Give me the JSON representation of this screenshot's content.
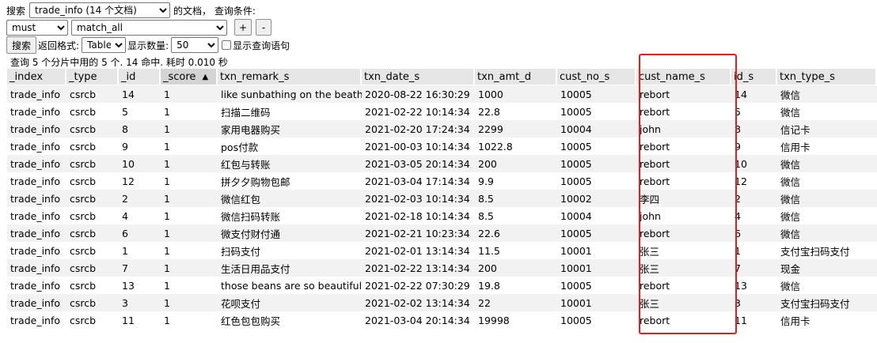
{
  "search_bar": {
    "label": "搜索",
    "index_select": "trade_info (14 个文档)",
    "suffix": "的文档， 查询条件:",
    "bool_select": "must",
    "query_select": "match_all",
    "add_label": "+",
    "remove_label": "-"
  },
  "options_bar": {
    "search_button": "搜索",
    "format_label": "返回格式:",
    "format_select": "Table",
    "count_label": "显示数量:",
    "count_select": "50",
    "show_query_label": "显示查询语句"
  },
  "status_text": "查询 5 个分片中用的 5 个. 14 命中. 耗时 0.010 秒",
  "table": {
    "columns": [
      "_index",
      "_type",
      "_id",
      "_score",
      "txn_remark_s",
      "txn_date_s",
      "txn_amt_d",
      "cust_no_s",
      "cust_name_s",
      "id_s",
      "txn_type_s"
    ],
    "sort_indicator": "▲",
    "rows": [
      [
        "trade_info",
        "csrcb",
        "14",
        "1",
        "like sunbathing on the beath",
        "2020-08-22 16:30:29",
        "1000",
        "10005",
        "rebort",
        "14",
        "微信"
      ],
      [
        "trade_info",
        "csrcb",
        "5",
        "1",
        "扫描二维码",
        "2021-02-22 10:14:34",
        "22.8",
        "10005",
        "rebort",
        "5",
        "微信"
      ],
      [
        "trade_info",
        "csrcb",
        "8",
        "1",
        "家用电器购买",
        "2021-02-20 17:24:34",
        "2299",
        "10004",
        "john",
        "8",
        "信记卡"
      ],
      [
        "trade_info",
        "csrcb",
        "9",
        "1",
        "pos付款",
        "2021-00-03 10:14:34",
        "1022.8",
        "10005",
        "rebort",
        "9",
        "信用卡"
      ],
      [
        "trade_info",
        "csrcb",
        "10",
        "1",
        "红包与转账",
        "2021-03-05 20:14:34",
        "200",
        "10005",
        "rebort",
        "10",
        "微信"
      ],
      [
        "trade_info",
        "csrcb",
        "12",
        "1",
        "拼夕夕购物包邮",
        "2021-03-04 17:14:34",
        "9.9",
        "10005",
        "rebort",
        "12",
        "微信"
      ],
      [
        "trade_info",
        "csrcb",
        "2",
        "1",
        "微信红包",
        "2021-02-03 10:14:34",
        "8.5",
        "10002",
        "李四",
        "2",
        "微信"
      ],
      [
        "trade_info",
        "csrcb",
        "4",
        "1",
        "微信扫码转账",
        "2021-02-18 10:14:34",
        "8.5",
        "10004",
        "john",
        "4",
        "微信"
      ],
      [
        "trade_info",
        "csrcb",
        "6",
        "1",
        "微支付财付通",
        "2021-02-21 10:23:34",
        "22.6",
        "10005",
        "rebort",
        "6",
        "微信"
      ],
      [
        "trade_info",
        "csrcb",
        "1",
        "1",
        "扫码支付",
        "2021-02-01 13:14:34",
        "11.5",
        "10001",
        "张三",
        "1",
        "支付宝扫码支付"
      ],
      [
        "trade_info",
        "csrcb",
        "7",
        "1",
        "生活日用品支付",
        "2021-02-22 13:14:34",
        "200",
        "10001",
        "张三",
        "7",
        "现金"
      ],
      [
        "trade_info",
        "csrcb",
        "13",
        "1",
        "those beans are so beautiful",
        "2021-02-22 07:30:29",
        "19.8",
        "10005",
        "rebort",
        "13",
        "微信"
      ],
      [
        "trade_info",
        "csrcb",
        "3",
        "1",
        "花呗支付",
        "2021-02-02 13:14:34",
        "22",
        "10001",
        "张三",
        "3",
        "支付宝扫码支付"
      ],
      [
        "trade_info",
        "csrcb",
        "11",
        "1",
        "红色包包购买",
        "2021-03-04 20:14:34",
        "19998",
        "10005",
        "rebort",
        "11",
        "信用卡"
      ]
    ]
  },
  "colors": {
    "highlight_border": "#e02020",
    "header_bg": "#e6e6e6",
    "alt_row_bg": "#f2f2f2"
  }
}
